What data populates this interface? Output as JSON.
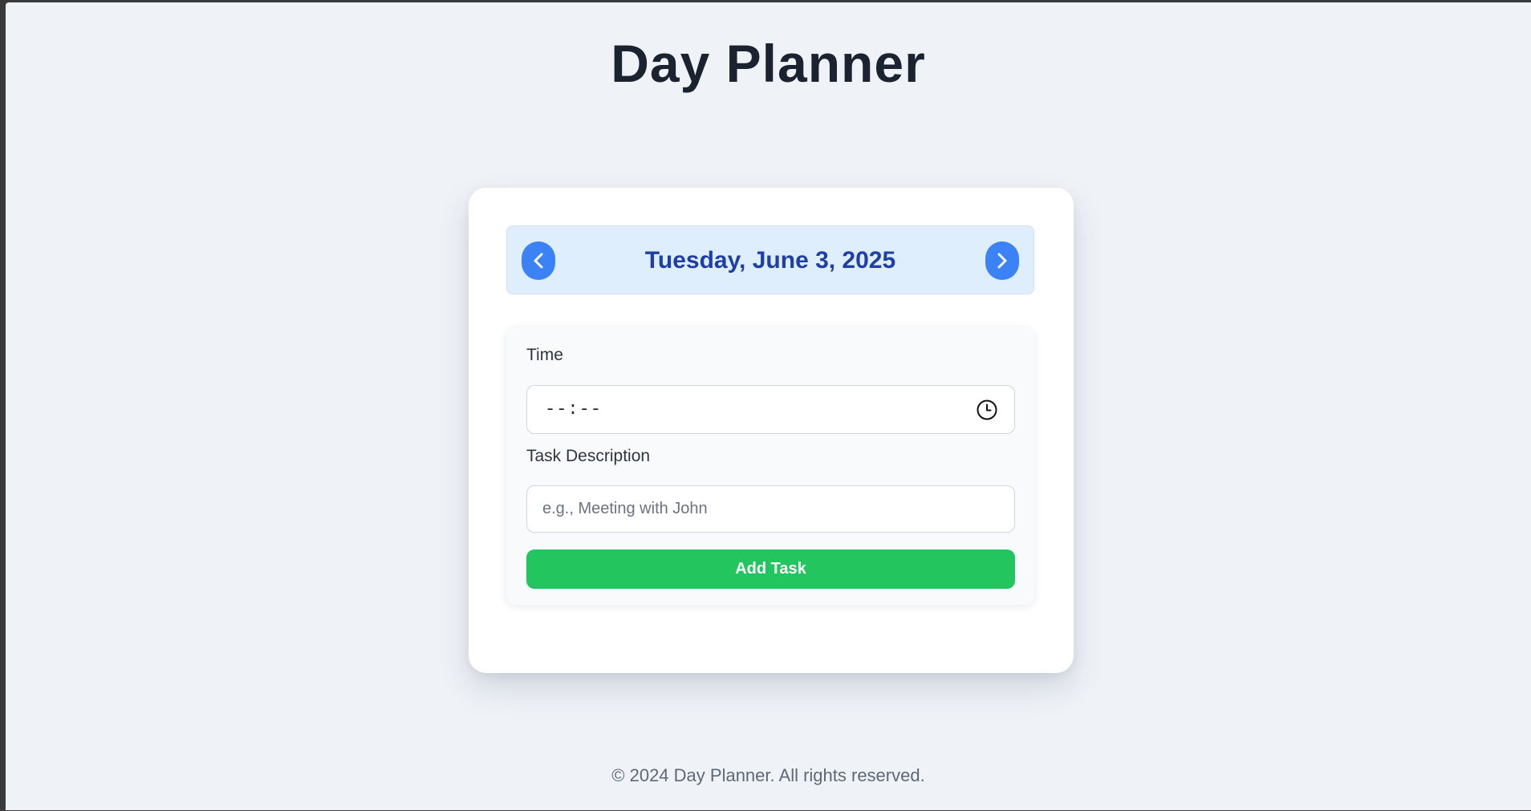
{
  "app": {
    "title": "Day Planner"
  },
  "date_nav": {
    "current_date": "Tuesday, June 3, 2025",
    "prev_icon": "chevron-left-icon",
    "next_icon": "chevron-right-icon"
  },
  "form": {
    "time_label": "Time",
    "time_value": "--:--",
    "time_icon": "clock-icon",
    "task_label": "Task Description",
    "task_value": "",
    "task_placeholder": "e.g., Meeting with John",
    "add_button_label": "Add Task"
  },
  "footer": {
    "text": "© 2024 Day Planner. All rights reserved."
  },
  "colors": {
    "page_background": "#eff3f8",
    "nav_background": "#dfeefc",
    "nav_button": "#3b82f6",
    "date_text": "#1e3fa8",
    "add_button": "#22c55e",
    "title_text": "#1b2330"
  }
}
